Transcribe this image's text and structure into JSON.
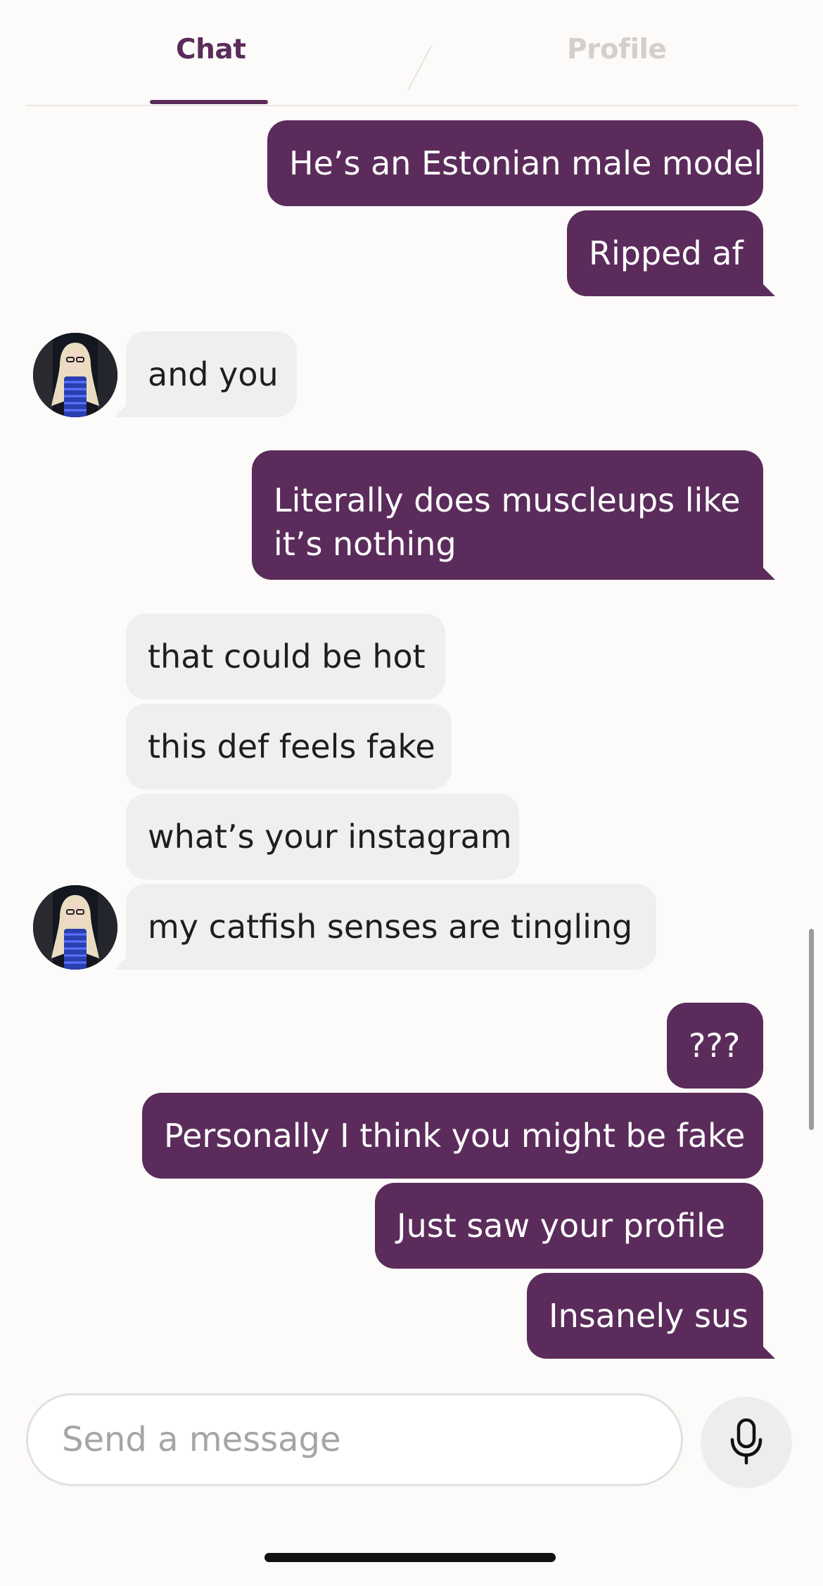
{
  "tabs": {
    "chat": "Chat",
    "profile": "Profile",
    "active": "chat"
  },
  "colors": {
    "accent": "#5b2c5b",
    "outgoing_bubble": "#5b2c5b",
    "incoming_bubble": "#efefef",
    "inactive_tab": "#d2cfcd",
    "background": "#fcfbf9"
  },
  "messages": [
    {
      "direction": "outgoing",
      "text": "He’s an Estonian male model"
    },
    {
      "direction": "outgoing",
      "text": "Ripped af"
    },
    {
      "direction": "incoming",
      "text": "and you"
    },
    {
      "direction": "outgoing",
      "text": "Literally does muscleups like it’s nothing"
    },
    {
      "direction": "incoming",
      "text": "that could be hot"
    },
    {
      "direction": "incoming",
      "text": "this def feels fake"
    },
    {
      "direction": "incoming",
      "text": "what’s your instagram"
    },
    {
      "direction": "incoming",
      "text": "my catfish senses are tingling"
    },
    {
      "direction": "outgoing",
      "text": "???"
    },
    {
      "direction": "outgoing",
      "text": "Personally I think you might be fake"
    },
    {
      "direction": "outgoing",
      "text": "Just saw your profile"
    },
    {
      "direction": "outgoing",
      "text": "Insanely sus"
    }
  ],
  "composer": {
    "placeholder": "Send a message",
    "mic_icon": "microphone-icon"
  },
  "avatar": {
    "icon": "contact-photo"
  }
}
